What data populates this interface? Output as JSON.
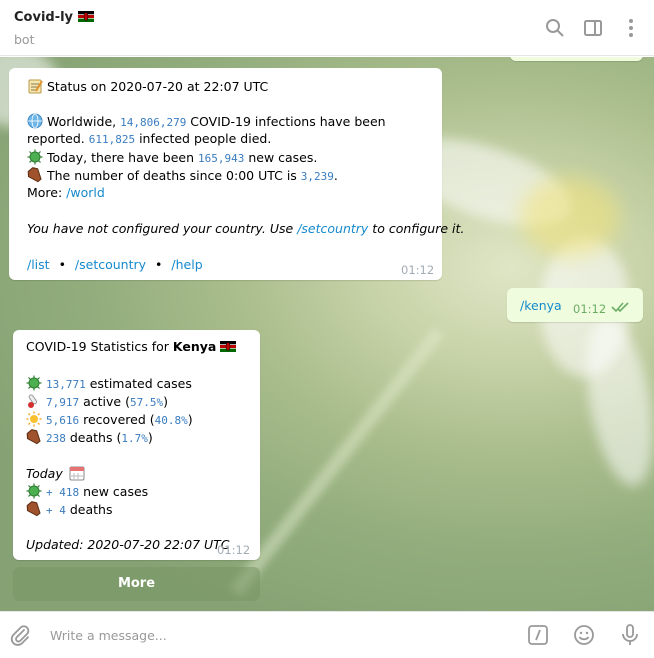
{
  "header": {
    "title": "Covid-ly",
    "flag": "🇰🇪",
    "subtitle": "bot"
  },
  "msg1": {
    "status_prefix": "Status on 2020-07-20 at 22:07 UTC",
    "worldwide_pre": "Worldwide, ",
    "infections": "14,806,279",
    "worldwide_post": " COVID-19 infections have been",
    "reported_pre": "reported. ",
    "deaths": "611,825",
    "reported_post": " infected people died.",
    "today_pre": "Today, there have been ",
    "new_cases": "165,943",
    "today_post": " new cases.",
    "deaths_since_pre": "The number of deaths since 0:00 UTC is ",
    "deaths_since": "3,239",
    "deaths_since_post": ".",
    "more_label": "More: ",
    "more_link": "/world",
    "config_pre": "You have not configured your country. Use ",
    "config_link": "/setcountry",
    "config_post": " to configure it.",
    "cmd_list": "/list",
    "cmd_setcountry": "/setcountry",
    "cmd_help": "/help",
    "separator": "•",
    "time": "01:12"
  },
  "msg2": {
    "text": "/kenya",
    "time": "01:12"
  },
  "msg3": {
    "title_pre": "COVID-19 Statistics for ",
    "country": "Kenya",
    "flag": "🇰🇪",
    "estimated": "13,771",
    "estimated_label": " estimated cases",
    "active": "7,917",
    "active_label": " active (",
    "active_pct": "57.5%",
    "close_paren": ")",
    "recovered": "5,616",
    "recovered_label": " recovered (",
    "recovered_pct": "40.8%",
    "deaths": "238",
    "deaths_label": " deaths (",
    "deaths_pct": "1.7%",
    "today_label": "Today",
    "new_cases": "+ 418",
    "new_cases_label": " new cases",
    "new_deaths": "+ 4",
    "new_deaths_label": " deaths",
    "updated": "Updated: 2020-07-20 22:07 UTC",
    "time": "01:12"
  },
  "keyboard": {
    "more_button": "More"
  },
  "composer": {
    "placeholder": "Write a message..."
  },
  "colors": {
    "link": "#168acd",
    "mono": "#3a7cc0",
    "outgoing_bubble": "#effdde",
    "check": "#6cad66"
  }
}
